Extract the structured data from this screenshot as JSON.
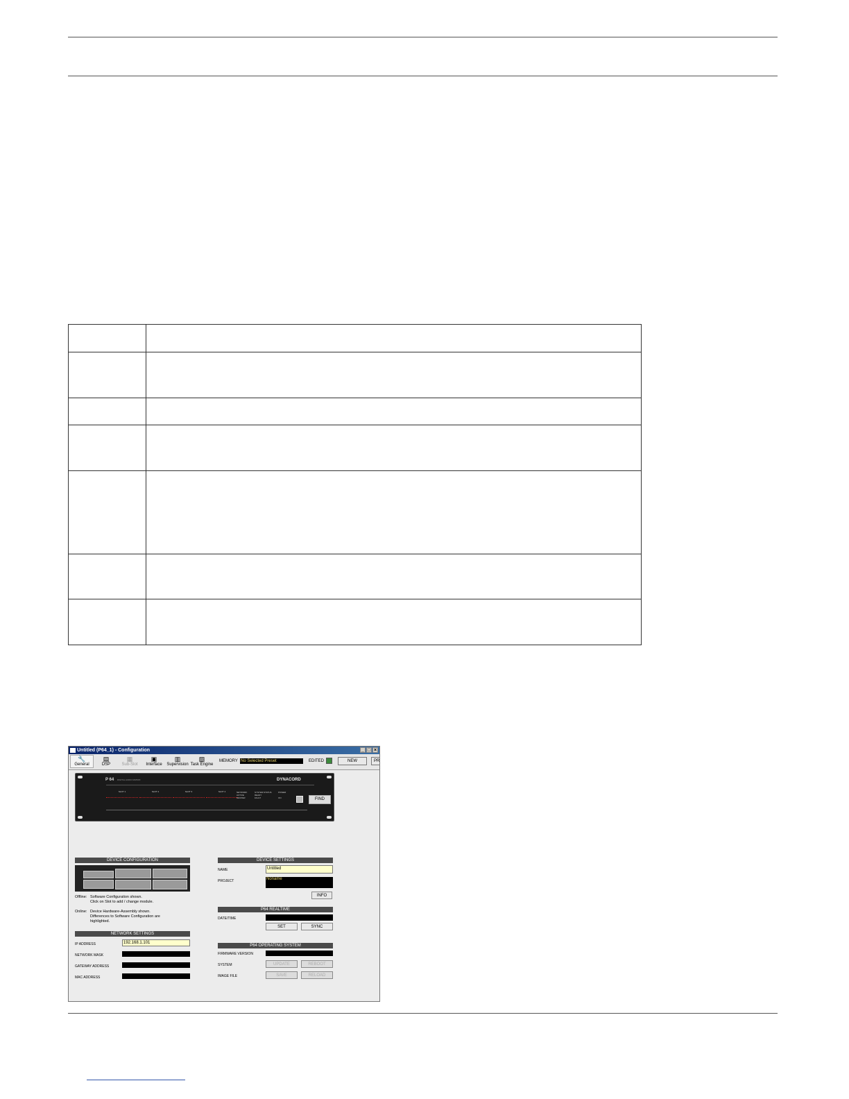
{
  "window": {
    "title": "Untitled (P64_1) - Configuration",
    "controls": [
      "_",
      "□",
      "×"
    ]
  },
  "toolbar": {
    "tabs": [
      {
        "label": "General",
        "icon": "wrench-icon",
        "glyph": "🔧"
      },
      {
        "label": "DSP",
        "icon": "dsp-icon",
        "glyph": "▤"
      },
      {
        "label": "Sub-Slot",
        "icon": "slot-icon",
        "glyph": "▦"
      },
      {
        "label": "Interface",
        "icon": "interface-icon",
        "glyph": "▣"
      },
      {
        "label": "Supervision",
        "icon": "supervision-icon",
        "glyph": "▥"
      },
      {
        "label": "Task Engine",
        "icon": "task-engine-icon",
        "glyph": "▧"
      }
    ],
    "memory_label": "MEMORY",
    "memory_value": "No Selected Preset",
    "edited_label": "EDITED",
    "new_label": "NEW",
    "pr_label": "PR"
  },
  "device": {
    "model": "P 64",
    "subtitle": "DIGITAL AUDIO MATRIX",
    "brand": "DYNACORD",
    "slots": [
      "SLOT 1",
      "SLOT 2",
      "SLOT 3",
      "SLOT 4"
    ],
    "peak_label": "PEAK\nDIMM",
    "network_status": "NETWORK\nACTIVE\nMASTER",
    "system_status": "SYSTEM STATUS\nREADY\nFAULT",
    "power_status": "POWER\n\nON",
    "find_label": "FIND"
  },
  "device_configuration": {
    "header": "DEVICE CONFIGURATION",
    "note_offline_label": "Offline:",
    "note_offline_text": "Software Configuration shown.\nClick on Slot to add / change module.",
    "note_online_label": "Online:",
    "note_online_text": "Device Hardware-Assembly shown.\nDifferences to Software Configuration are\nhighlighted."
  },
  "network_settings": {
    "header": "NETWORK SETTINGS",
    "ip_label": "IP ADDRESS",
    "ip_value": "192.168.1.101",
    "mask_label": "NETWORK MASK",
    "gateway_label": "GATEWAY ADDRESS",
    "mac_label": "MAC ADDRESS"
  },
  "device_settings": {
    "header": "DEVICE SETTINGS",
    "name_label": "NAME",
    "name_value": "Untitled",
    "project_label": "PROJECT",
    "project_value": "Noname",
    "info_label": "INFO"
  },
  "realtime": {
    "header": "P64 REALTIME",
    "datetime_label": "DATE/TIME",
    "set_label": "SET",
    "sync_label": "SYNC"
  },
  "os": {
    "header": "P64 OPERATING SYSTEM",
    "firmware_label": "FIRMWARE VERSION",
    "system_label": "SYSTEM",
    "update_label": "UPDATE",
    "reboot_label": "REBOOT",
    "image_label": "IMAGE FILE",
    "save_label": "SAVE",
    "reload_label": "RELOAD"
  }
}
